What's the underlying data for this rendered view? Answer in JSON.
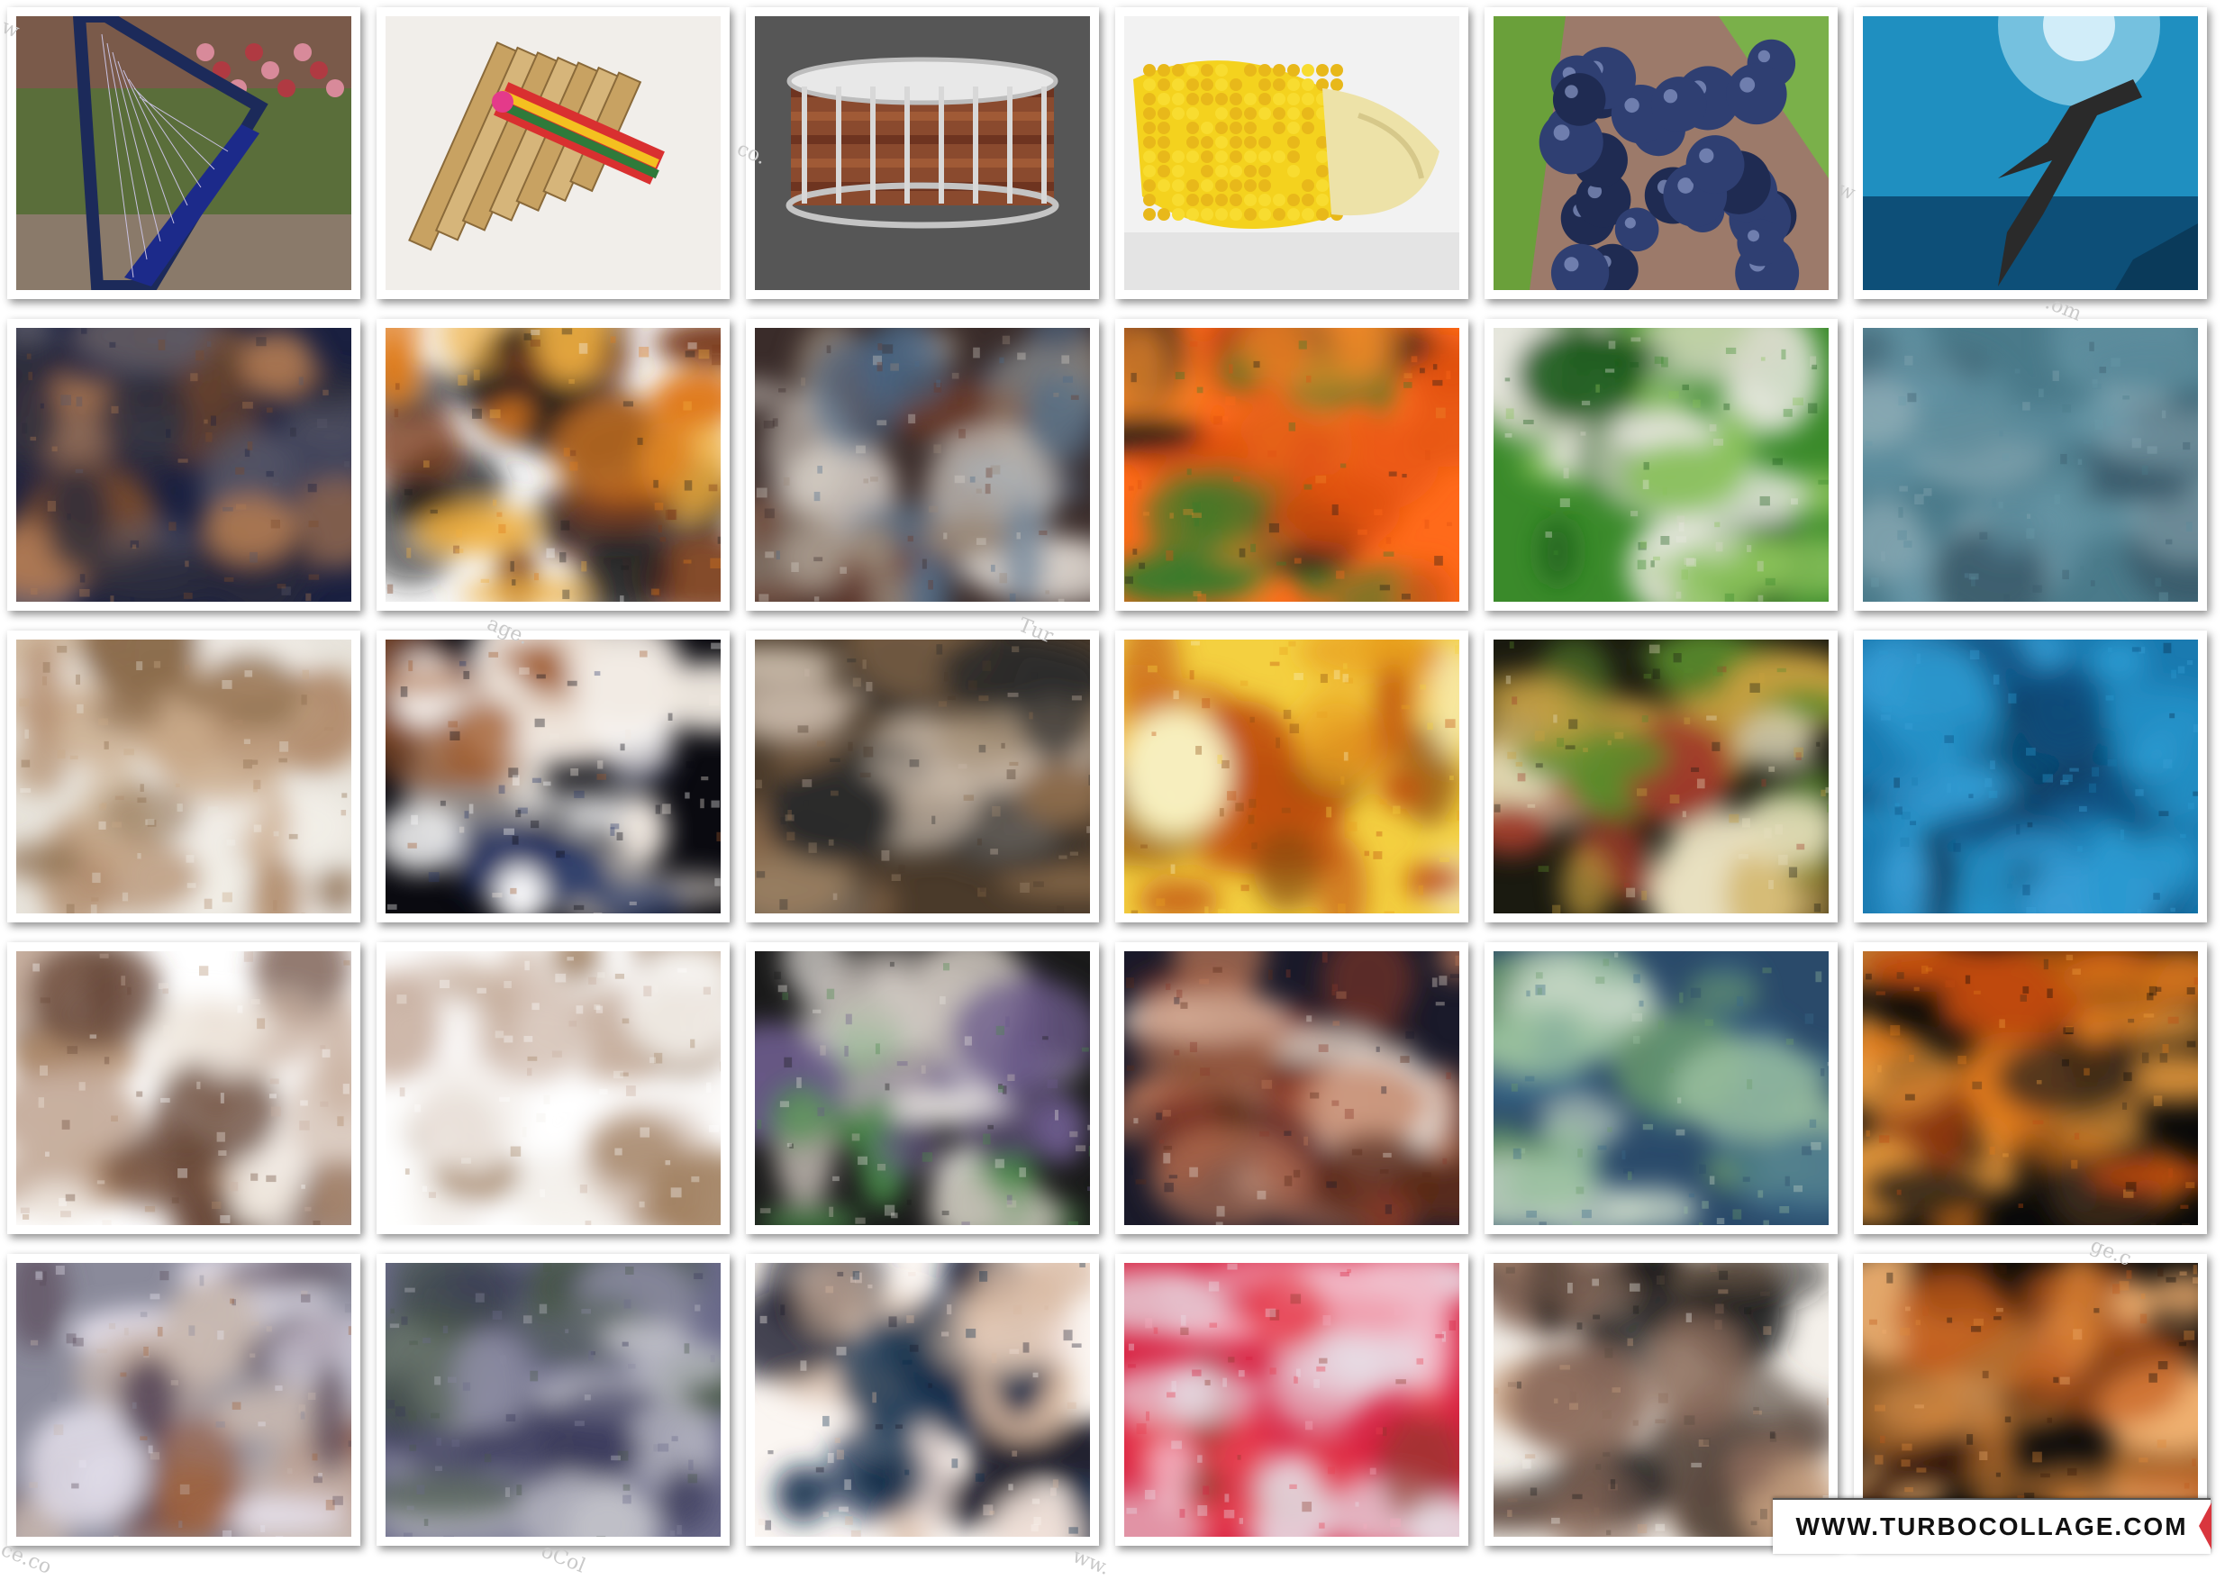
{
  "banner": {
    "text": "WWW.TURBOCOLLAGE.COM",
    "accent": "#d9363e"
  },
  "grid": {
    "rows": 5,
    "cols": 6
  },
  "tiles": [
    {
      "subject": "harp",
      "palette": [
        "#2a2f6b",
        "#6f8a3a",
        "#c9c2b2",
        "#b03a42",
        "#1c2a5a"
      ]
    },
    {
      "subject": "pan-flute",
      "palette": [
        "#f1eeea",
        "#d6b57a",
        "#b58a4a",
        "#d93030",
        "#2f7a3a"
      ]
    },
    {
      "subject": "snare-drum",
      "palette": [
        "#565656",
        "#8a4a2e",
        "#c4c4c4",
        "#6e3420",
        "#2b2b2b"
      ]
    },
    {
      "subject": "corn",
      "palette": [
        "#f2f2f2",
        "#f4d21e",
        "#e8a91a",
        "#ede2a8",
        "#cfcfcf"
      ]
    },
    {
      "subject": "grapes",
      "palette": [
        "#3b4f8a",
        "#1f2b52",
        "#6aa03a",
        "#9c7a6a",
        "#c4c8d6"
      ]
    },
    {
      "subject": "shark",
      "palette": [
        "#1f8fc0",
        "#0d4f78",
        "#9ad6ec",
        "#2a2a2a",
        "#0a3a5a"
      ]
    },
    {
      "subject": "blur",
      "palette": [
        "#1a2040",
        "#7a4a2a",
        "#b07a52",
        "#2b2b3a",
        "#5a5a6a"
      ]
    },
    {
      "subject": "blur",
      "palette": [
        "#f6f6f6",
        "#e07a1a",
        "#1c1c1c",
        "#f0b040",
        "#7a3a1a"
      ]
    },
    {
      "subject": "blur",
      "palette": [
        "#3a2c2a",
        "#9a8a7a",
        "#d8d0c8",
        "#4a6a8a",
        "#6a3a2a"
      ]
    },
    {
      "subject": "blur",
      "palette": [
        "#ff6a1a",
        "#ee8a2a",
        "#1a1a1a",
        "#3a7a2a",
        "#e05010"
      ]
    },
    {
      "subject": "blur",
      "palette": [
        "#3a8a2a",
        "#d8d8c8",
        "#1a5a1a",
        "#8ac25a",
        "#e8e8e0"
      ]
    },
    {
      "subject": "blur",
      "palette": [
        "#4a7a8a",
        "#6a9aaa",
        "#3a5a6a",
        "#8aaab4",
        "#5a8a9a"
      ]
    },
    {
      "subject": "blur",
      "palette": [
        "#e8e4dc",
        "#b08a6a",
        "#c8a888",
        "#8a6a4a",
        "#f4f0ea"
      ]
    },
    {
      "subject": "blur",
      "palette": [
        "#0a0a10",
        "#ffffff",
        "#2a3a6a",
        "#a05a2a",
        "#f0e8e0"
      ]
    },
    {
      "subject": "blur",
      "palette": [
        "#4a3a2a",
        "#8a6a4a",
        "#c8b8a8",
        "#2a2a2a",
        "#a08a70"
      ]
    },
    {
      "subject": "blur",
      "palette": [
        "#f4d040",
        "#e8a020",
        "#c05010",
        "#f8f0c0",
        "#8a4a10"
      ]
    },
    {
      "subject": "blur",
      "palette": [
        "#1a1a10",
        "#5a8a2a",
        "#c8a040",
        "#a03a2a",
        "#e8e0c0"
      ]
    },
    {
      "subject": "blur",
      "palette": [
        "#1a7ab0",
        "#0a4a7a",
        "#2a9ad0",
        "#0a2a4a",
        "#3aa0d8"
      ]
    },
    {
      "subject": "blur",
      "palette": [
        "#ffffff",
        "#b08a6a",
        "#6a4a3a",
        "#c8b0a0",
        "#f0e8e0"
      ]
    },
    {
      "subject": "blur",
      "palette": [
        "#ffffff",
        "#ffffff",
        "#a08060",
        "#f4f0ec",
        "#c8b0a0"
      ]
    },
    {
      "subject": "blur",
      "palette": [
        "#1a1a1a",
        "#c8c0b8",
        "#e8e4e0",
        "#4a8a4a",
        "#6a5a8a"
      ]
    },
    {
      "subject": "blur",
      "palette": [
        "#1a1a2a",
        "#8a3a2a",
        "#c07a5a",
        "#e8e0d8",
        "#5a2a1a"
      ]
    },
    {
      "subject": "blur",
      "palette": [
        "#2a4a6a",
        "#9ac0a0",
        "#c8d8c8",
        "#6a9a6a",
        "#3a6a8a"
      ]
    },
    {
      "subject": "blur",
      "palette": [
        "#0a0a0a",
        "#e07a1a",
        "#c04a10",
        "#3a2a1a",
        "#f0a040"
      ]
    },
    {
      "subject": "blur",
      "palette": [
        "#8a8a9a",
        "#5a4a5a",
        "#c8b8b0",
        "#a0603a",
        "#e8e4f0"
      ]
    },
    {
      "subject": "blur",
      "palette": [
        "#6a6a8a",
        "#8a8aa0",
        "#4a5a4a",
        "#c0c0c8",
        "#3a3a5a"
      ]
    },
    {
      "subject": "blur",
      "palette": [
        "#fbf6f2",
        "#d8b8a0",
        "#0a2a4a",
        "#1a1a2a",
        "#f0e0d8"
      ]
    },
    {
      "subject": "blur",
      "palette": [
        "#d82040",
        "#e84050",
        "#e8e0e8",
        "#8a3a2a",
        "#f4b0c0"
      ]
    },
    {
      "subject": "blur",
      "palette": [
        "#f4f0ea",
        "#8a6a5a",
        "#1a1a1a",
        "#c8a080",
        "#5a4a40"
      ]
    },
    {
      "subject": "blur",
      "palette": [
        "#0a0a0a",
        "#e08a3a",
        "#f0b070",
        "#3a1a0a",
        "#c05a1a"
      ]
    }
  ]
}
